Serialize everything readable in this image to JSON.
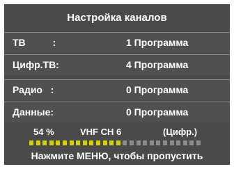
{
  "title": "Настройка каналов",
  "rows": [
    {
      "label": "ТВ          :",
      "value": "1 Программа"
    },
    {
      "label": "Цифр.ТВ:",
      "value": "4 Программа"
    },
    {
      "label": "Радио   :",
      "value": "0 Программа"
    },
    {
      "label": "Данные:",
      "value": "0 Программа"
    }
  ],
  "status": {
    "percent": "54 %",
    "channel": "VHF CH 6",
    "mode": "(Цифр.)"
  },
  "progress": {
    "fraction": 0.54,
    "filled_color": "#d6d200",
    "empty_color": "#8c8c8c"
  },
  "hint": "Нажмите МЕНЮ, чтобы пропустить"
}
